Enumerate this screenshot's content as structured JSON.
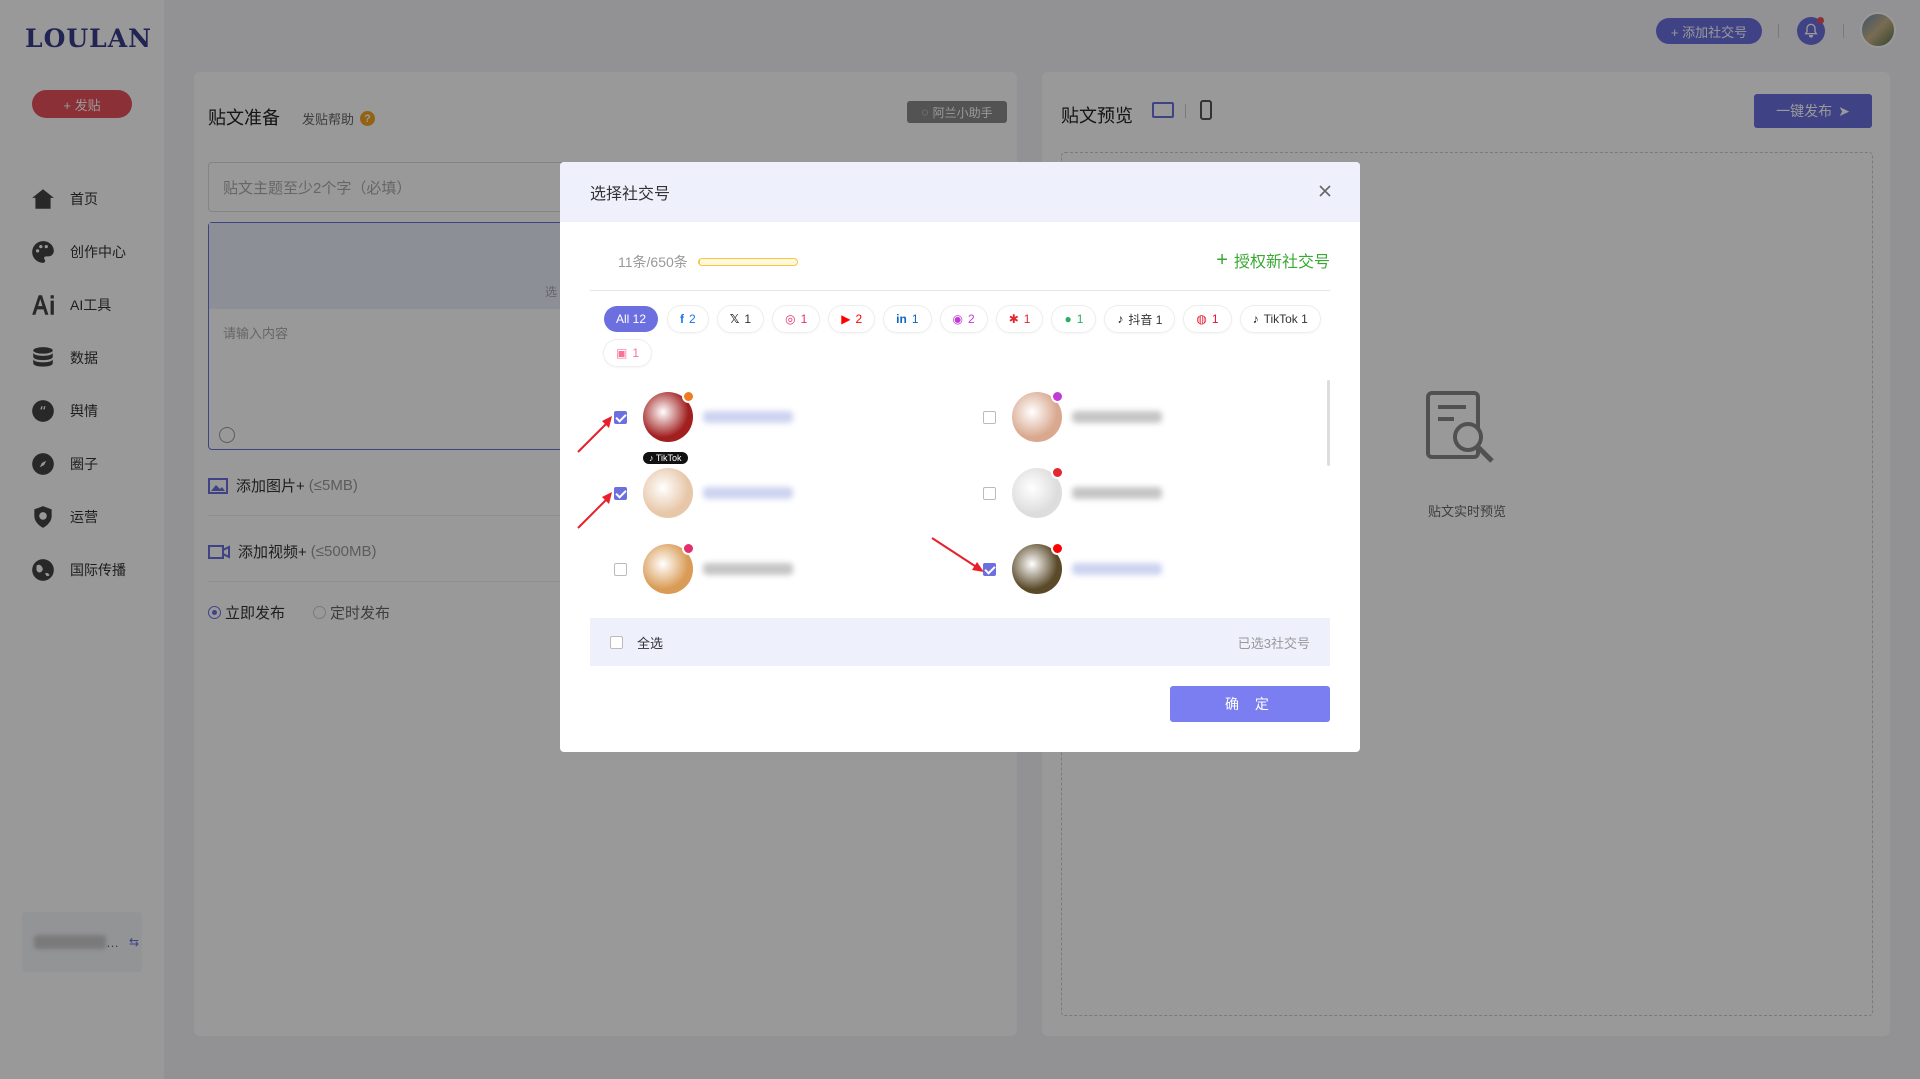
{
  "app": {
    "logo": "LOULAN",
    "post_button": "+ 发贴"
  },
  "sidebar": {
    "items": [
      {
        "label": "首页",
        "icon": "home-icon"
      },
      {
        "label": "创作中心",
        "icon": "palette-icon"
      },
      {
        "label": "AI工具",
        "icon": "ai-icon"
      },
      {
        "label": "数据",
        "icon": "database-icon"
      },
      {
        "label": "舆情",
        "icon": "quote-icon"
      },
      {
        "label": "圈子",
        "icon": "compass-icon"
      },
      {
        "label": "运营",
        "icon": "shield-icon"
      },
      {
        "label": "国际传播",
        "icon": "globe-icon"
      }
    ],
    "bottom_card_suffix": "…"
  },
  "topbar": {
    "add_account": "+ 添加社交号"
  },
  "left_panel": {
    "title": "贴文准备",
    "help": "发贴帮助",
    "help_mark": "?",
    "assistant": "阿兰小助手",
    "topic_placeholder": "贴文主题至少2个字（必填）",
    "content_placeholder": "请输入内容",
    "editor_truncated": "选",
    "add_image": "添加图片+",
    "add_image_hint": "(≤5MB)",
    "add_video": "添加视频+",
    "add_video_hint": "(≤500MB)",
    "publish_now": "立即发布",
    "publish_scheduled": "定时发布"
  },
  "right_panel": {
    "title": "贴文预览",
    "publish_button": "一键发布",
    "preview_label": "贴文实时预览"
  },
  "modal": {
    "title": "选择社交号",
    "quota": "11条/650条",
    "quota_fraction": 0.017,
    "authorize": "授权新社交号",
    "chips": [
      {
        "label": "All 12",
        "icon": "",
        "color": "#ffffff",
        "active": true
      },
      {
        "label": "2",
        "icon": "f",
        "color": "#1877f2"
      },
      {
        "label": "1",
        "icon": "𝕏",
        "color": "#333333"
      },
      {
        "label": "1",
        "icon": "◎",
        "color": "#e1306c"
      },
      {
        "label": "2",
        "icon": "▶",
        "color": "#ff0000"
      },
      {
        "label": "1",
        "icon": "in",
        "color": "#0a66c2"
      },
      {
        "label": "2",
        "icon": "◉",
        "color": "#c13bd6"
      },
      {
        "label": "1",
        "icon": "✱",
        "color": "#e0282e"
      },
      {
        "label": "1",
        "icon": "●",
        "color": "#2aae67"
      },
      {
        "label": "抖音 1",
        "icon": "♪",
        "color": "#111111"
      },
      {
        "label": "1",
        "icon": "◍",
        "color": "#e6162d"
      },
      {
        "label": "TikTok 1",
        "icon": "♪",
        "color": "#111111"
      },
      {
        "label": "1",
        "icon": "▣",
        "color": "#fb7299"
      }
    ],
    "accounts": [
      {
        "checked": true,
        "avatar_color": "#a11f1f",
        "badge_color": "#f07a22",
        "name_style": "blue"
      },
      {
        "checked": false,
        "avatar_color": "#d9a88f",
        "badge_color": "#c13bd6",
        "name_style": "gray"
      },
      {
        "checked": true,
        "avatar_color": "#e7c7a8",
        "badge_color": "",
        "tag": "TikTok",
        "name_style": "blue"
      },
      {
        "checked": false,
        "avatar_color": "#dddddd",
        "badge_color": "#e0282e",
        "name_style": "gray"
      },
      {
        "checked": false,
        "avatar_color": "#d99b55",
        "badge_color": "#e1306c",
        "name_style": "gray"
      },
      {
        "checked": true,
        "avatar_color": "#5a4a2a",
        "badge_color": "#ff0000",
        "name_style": "blue"
      }
    ],
    "select_all": "全选",
    "selected_count": "已选3社交号",
    "confirm": "确 定"
  },
  "colors": {
    "accent": "#6c6fe0",
    "brand": "#3a3e8c",
    "danger": "#e8505b",
    "success": "#3aa832"
  }
}
